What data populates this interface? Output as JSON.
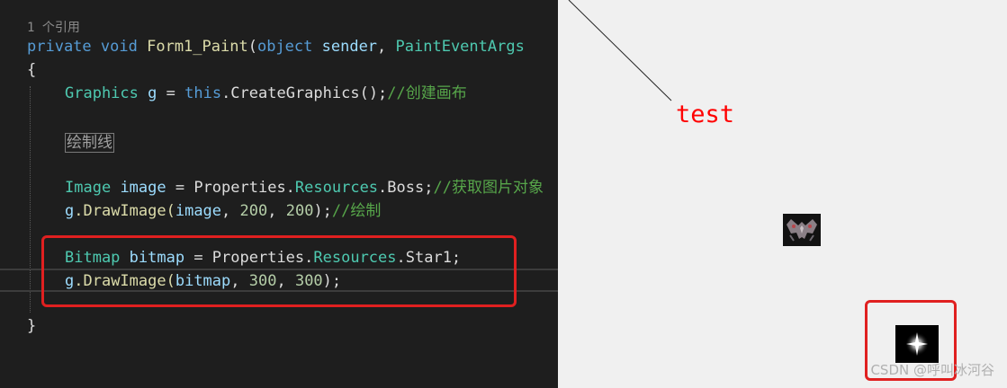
{
  "editor": {
    "ref_count": "1 个引用",
    "lines": {
      "sig_private": "private",
      "sig_void": "void",
      "sig_name": "Form1_Paint",
      "sig_paren": "(",
      "sig_object": "object",
      "sig_sender": "sender",
      "sig_comma": ", ",
      "sig_argtype": "PaintEventArgs",
      "open_brace": "{",
      "graphics_type": "Graphics",
      "graphics_var": "g",
      "graphics_eq": " = ",
      "graphics_this": "this",
      "graphics_call": ".CreateGraphics();",
      "graphics_comment": "//创建画布",
      "collapsed_region": "绘制线",
      "image_type": "Image",
      "image_var": "image",
      "image_eq": " = Properties.",
      "image_res": "Resources",
      "image_boss": ".Boss;",
      "image_comment": "//获取图片对象",
      "draw1_g": "g",
      "draw1_call": ".DrawImage(",
      "draw1_arg": "image",
      "draw1_n1": "200",
      "draw1_n2": "200",
      "draw1_end": ");",
      "draw1_comment": "//绘制",
      "bitmap_type": "Bitmap",
      "bitmap_var": "bitmap",
      "bitmap_eq": " = Properties.",
      "bitmap_res": "Resources",
      "bitmap_star": ".Star1;",
      "draw2_g": "g",
      "draw2_call": ".DrawImage(",
      "draw2_arg": "bitmap",
      "draw2_n1": "300",
      "draw2_n2": "300",
      "draw2_end": ");",
      "close_brace": "}"
    }
  },
  "form": {
    "test_label": "test",
    "watermark": "CSDN @呼叫冰河谷"
  },
  "colors": {
    "highlight_box": "#e02020",
    "keyword": "#569cd6",
    "type": "#4ec9b0",
    "comment": "#57a64a"
  }
}
